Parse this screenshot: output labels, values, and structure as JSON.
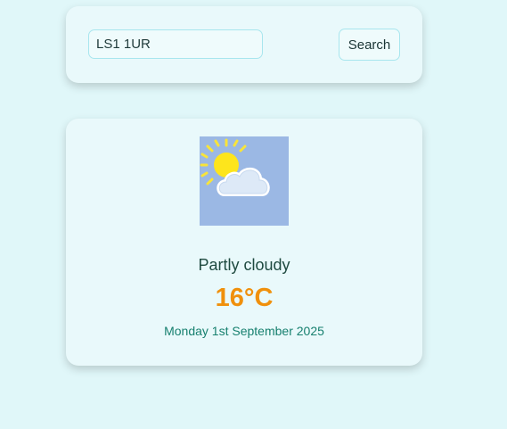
{
  "search": {
    "value": "LS1 1UR",
    "button_label": "Search"
  },
  "weather": {
    "icon": "partly-cloudy-icon",
    "condition": "Partly cloudy",
    "temperature": "16°C",
    "date": "Monday 1st September 2025"
  },
  "colors": {
    "background": "#e0f7f9",
    "card": "#e9f9fb",
    "temperature": "#f0900c",
    "date": "#17806f",
    "icon_background": "#9bb8e4"
  }
}
